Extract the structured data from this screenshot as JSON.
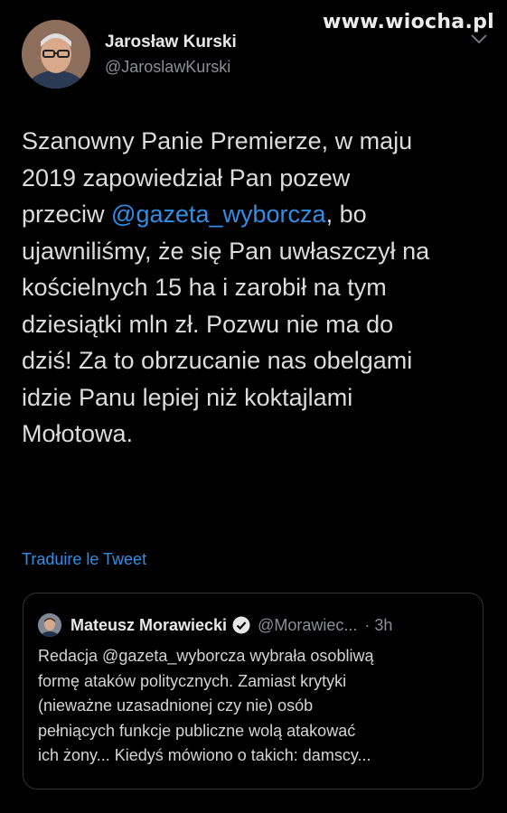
{
  "watermark": "www.wiocha.pl",
  "tweet": {
    "author_name": "Jarosław Kurski",
    "author_handle": "@JaroslawKurski",
    "text_part1": "Szanowny Panie Premierze, w maju\n2019 zapowiedział Pan pozew\nprzeciw ",
    "mention": "@gazeta_wyborcza",
    "text_part2": ", bo\nujawniliśmy, że się Pan uwłaszczył na\nkościelnych 15 ha i zarobił na tym\ndziesiątki mln zł. Pozwu nie ma do\ndziś! Za to obrzucanie nas obelgami\nidzie Panu lepiej niż koktajlami\nMołotowa.",
    "translate_label": "Traduire le Tweet"
  },
  "quoted_tweet": {
    "author_name": "Mateusz Morawiecki",
    "author_handle": "@Morawiec...",
    "time": "· 3h",
    "text": "Redacja @gazeta_wyborcza wybrała osobliwą\nformę ataków politycznych. Zamiast krytyki\n(nieważne uzasadnionej czy nie) osób\npełniących funkcje publiczne wolą atakować\nich żony... Kiedyś mówiono o takich: damscy..."
  },
  "icons": {
    "menu": "chevron-down-icon",
    "verified": "verified-badge-icon"
  }
}
